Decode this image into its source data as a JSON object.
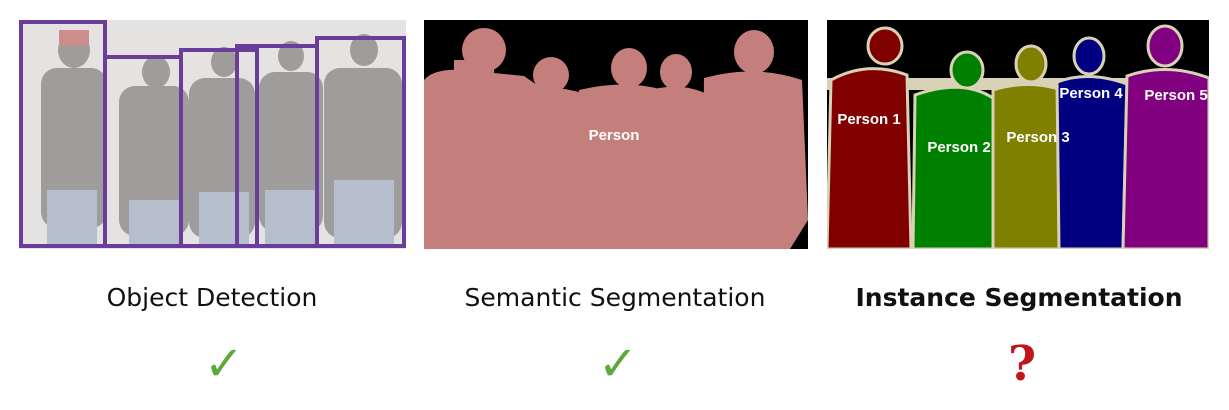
{
  "panels": [
    {
      "caption": "Object Detection",
      "mark": "✓",
      "mark_color": "#5fa83c",
      "box_color": "#6a3d9a"
    },
    {
      "caption": "Semantic Segmentation",
      "mark": "✓",
      "mark_color": "#5fa83c",
      "mask_color": "#c47f7c",
      "label": "Person"
    },
    {
      "caption": "Instance Segmentation",
      "mark": "?",
      "mark_color": "#c0151c",
      "instances": [
        {
          "label": "Person 1",
          "color": "#800000"
        },
        {
          "label": "Person 2",
          "color": "#008000"
        },
        {
          "label": "Person 3",
          "color": "#808000"
        },
        {
          "label": "Person 4",
          "color": "#000080"
        },
        {
          "label": "Person 5",
          "color": "#800080"
        }
      ]
    }
  ]
}
